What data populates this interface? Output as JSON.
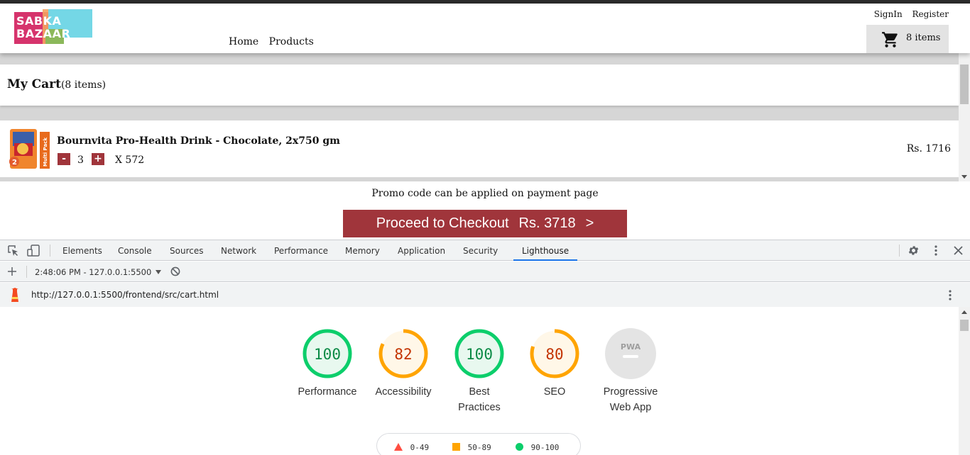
{
  "site": {
    "logo_line1": "SABKA",
    "logo_line2": "BAZAAR",
    "nav": [
      "Home",
      "Products"
    ],
    "auth": {
      "signin": "SignIn",
      "register": "Register"
    },
    "cart_button": {
      "count": "8 items"
    },
    "cart": {
      "title": "My Cart",
      "count": "(8 items)",
      "items": [
        {
          "name": "Bournvita Pro-Health Drink - Chocolate, 2x750 gm",
          "qty": "3",
          "minus": "-",
          "plus": "+",
          "unit_price": "X 572",
          "total": "Rs. 1716",
          "image": "bournvita-multipack-image"
        }
      ]
    },
    "promo": "Promo code can be applied on payment page",
    "checkout": {
      "label": "Proceed to Checkout",
      "amount": "Rs. 3718",
      "arrow": ">"
    }
  },
  "devtools": {
    "tabs": [
      "Elements",
      "Console",
      "Sources",
      "Network",
      "Performance",
      "Memory",
      "Application",
      "Security",
      "Lighthouse"
    ],
    "active_tab": "Lighthouse",
    "report_select": "2:48:06 PM - 127.0.0.1:5500",
    "url": "http://127.0.0.1:5500/frontend/src/cart.html",
    "categories": [
      {
        "score": "100",
        "label": "Performance",
        "value": 100,
        "color": "#0cce6b",
        "fill": "#e8f8ef"
      },
      {
        "score": "82",
        "label": "Accessibility",
        "value": 82,
        "color": "#ffa400",
        "fill": "#fff7e8"
      },
      {
        "score": "100",
        "label": "Best Practices",
        "value": 100,
        "color": "#0cce6b",
        "fill": "#e8f8ef"
      },
      {
        "score": "80",
        "label": "SEO",
        "value": 80,
        "color": "#ffa400",
        "fill": "#fff7e8"
      },
      {
        "score": "",
        "label": "Progressive Web App",
        "value": null,
        "badge": "PWA",
        "color": "#dddddd",
        "fill": "#e4e4e4"
      }
    ],
    "legend": [
      {
        "range": "0-49",
        "color": "#ff4e42",
        "shape": "triangle"
      },
      {
        "range": "50-89",
        "color": "#ffa400",
        "shape": "square"
      },
      {
        "range": "90-100",
        "color": "#0cce6b",
        "shape": "circle"
      }
    ]
  }
}
